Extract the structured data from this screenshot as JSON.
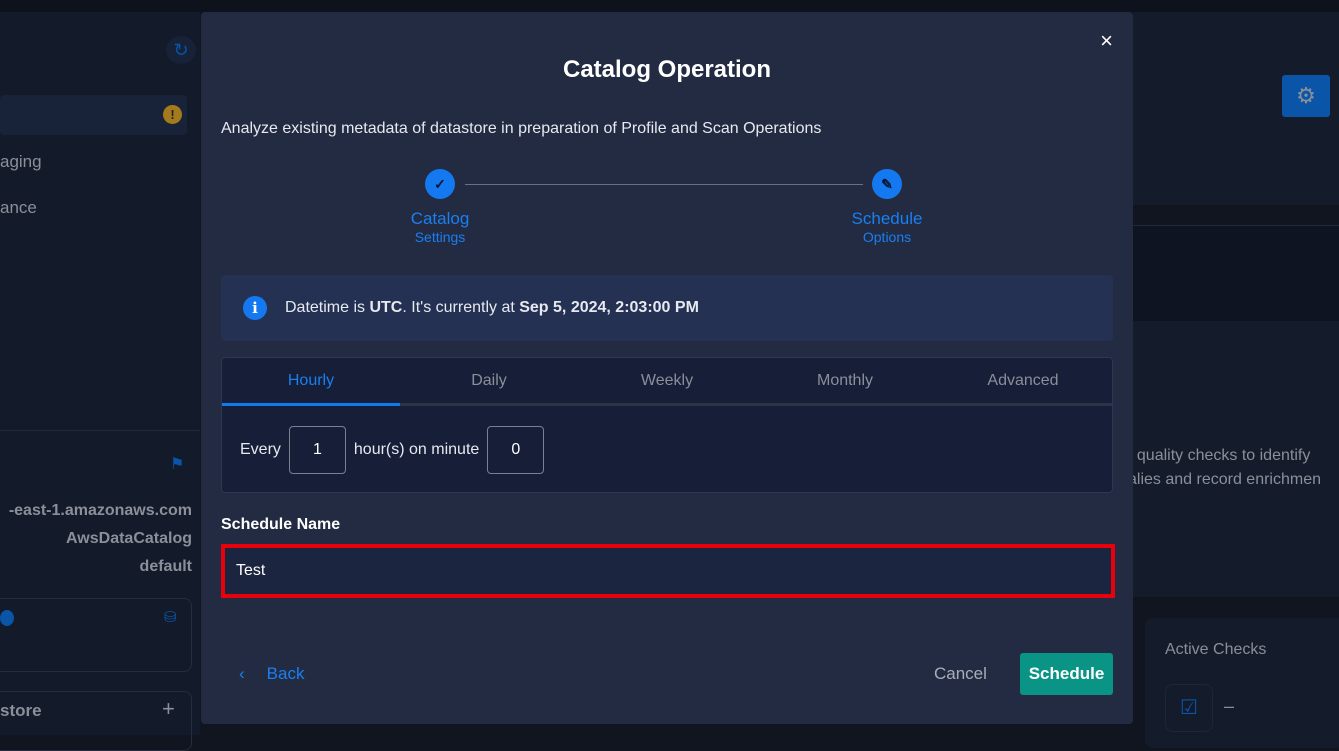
{
  "background": {
    "sidebar_items": [
      "aging",
      "ance"
    ],
    "host": "-east-1.amazonaws.com",
    "catalog": "AwsDataCatalog",
    "database": "default",
    "datastore_label": "store",
    "description_lines": [
      "t quality checks to identify",
      "alies and record enrichmen"
    ],
    "active_checks_label": "Active Checks",
    "active_checks_value": "–"
  },
  "modal": {
    "title": "Catalog Operation",
    "close_icon": "×",
    "description": "Analyze existing metadata of datastore in preparation of Profile and Scan Operations",
    "steps": [
      {
        "title": "Catalog",
        "subtitle": "Settings",
        "icon": "check-icon",
        "glyph": "✓"
      },
      {
        "title": "Schedule",
        "subtitle": "Options",
        "icon": "pencil-icon",
        "glyph": "✎"
      }
    ],
    "info": {
      "prefix": "Datetime is ",
      "tz": "UTC",
      "middle": ". It's currently at ",
      "datetime": "Sep 5, 2024, 2:03:00 PM"
    },
    "tabs": [
      "Hourly",
      "Daily",
      "Weekly",
      "Monthly",
      "Advanced"
    ],
    "active_tab": "Hourly",
    "hourly": {
      "every_label": "Every",
      "hours": "1",
      "mid_label": "hour(s) on minute",
      "minute": "0"
    },
    "schedule_name_label": "Schedule Name",
    "schedule_name_value": "Test",
    "back_label": "Back",
    "cancel_label": "Cancel",
    "schedule_label": "Schedule"
  },
  "colors": {
    "accent": "#1479f0",
    "primary_button": "#0a9486",
    "highlight": "#e8000b",
    "modal_bg": "#222b42"
  }
}
